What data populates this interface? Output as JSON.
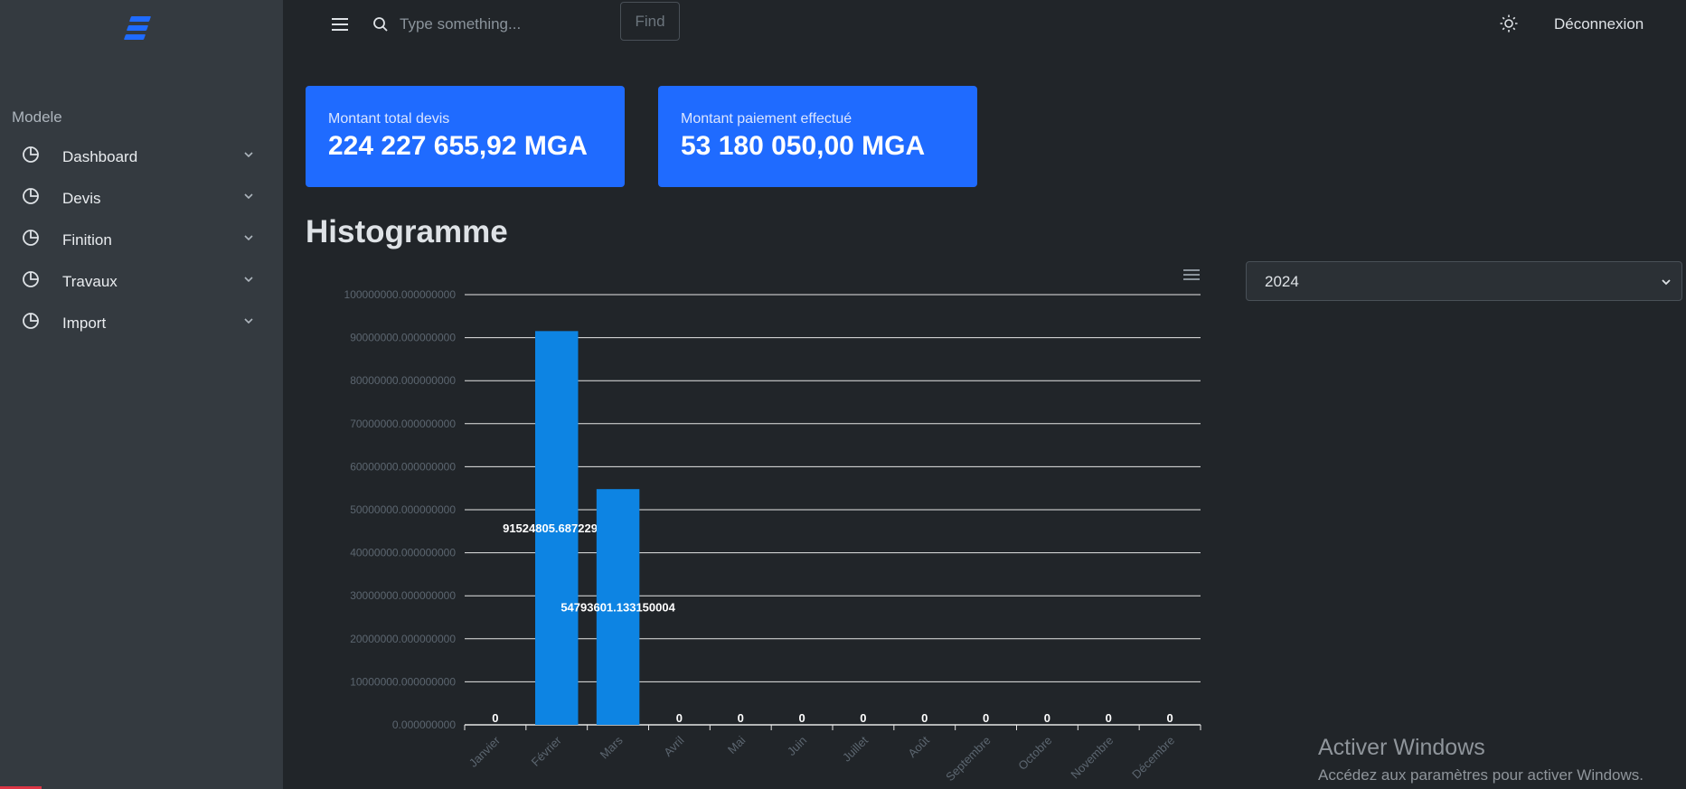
{
  "sidebar": {
    "section_title": "Modele",
    "items": [
      {
        "label": "Dashboard",
        "icon": "pie-chart-icon"
      },
      {
        "label": "Devis",
        "icon": "pie-chart-icon"
      },
      {
        "label": "Finition",
        "icon": "pie-chart-icon"
      },
      {
        "label": "Travaux",
        "icon": "pie-chart-icon"
      },
      {
        "label": "Import",
        "icon": "pie-chart-icon"
      }
    ]
  },
  "topbar": {
    "search_placeholder": "Type something...",
    "find_label": "Find",
    "logout_label": "Déconnexion"
  },
  "cards": [
    {
      "title": "Montant total devis",
      "value": "224 227 655,92 MGA"
    },
    {
      "title": "Montant paiement effectué",
      "value": "53 180 050,00 MGA"
    }
  ],
  "section": {
    "heading": "Histogramme"
  },
  "year_select": {
    "value": "2024"
  },
  "colors": {
    "accent": "#1f6bff",
    "bar": "#0d84e3",
    "background": "#212529",
    "sidebar": "#343a40"
  },
  "chart_data": {
    "type": "bar",
    "categories": [
      "Janvier",
      "Février",
      "Mars",
      "Avril",
      "Mai",
      "Juin",
      "Juillet",
      "Août",
      "Septembre",
      "Octobre",
      "Novembre",
      "Décembre"
    ],
    "values": [
      0,
      91524805.68722999,
      54793601.133150004,
      0,
      0,
      0,
      0,
      0,
      0,
      0,
      0,
      0
    ],
    "data_labels": [
      "0",
      "91524805.68722999",
      "54793601.133150004",
      "0",
      "0",
      "0",
      "0",
      "0",
      "0",
      "0",
      "0",
      "0"
    ],
    "y_ticks": [
      "0.000000000",
      "10000000.000000000",
      "20000000.000000000",
      "30000000.000000000",
      "40000000.000000000",
      "50000000.000000000",
      "60000000.000000000",
      "70000000.000000000",
      "80000000.000000000",
      "90000000.000000000",
      "100000000.000000000"
    ],
    "ylim": [
      0,
      100000000
    ],
    "grid": true
  },
  "watermark": {
    "title": "Activer Windows",
    "subtitle": "Accédez aux paramètres pour activer Windows."
  }
}
